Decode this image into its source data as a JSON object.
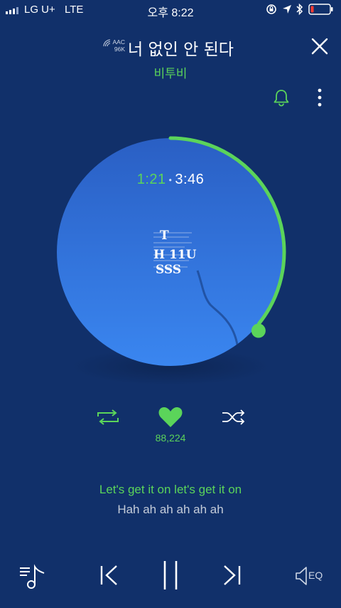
{
  "status_bar": {
    "carrier": "LG U+",
    "network": "LTE",
    "time": "오후 8:22"
  },
  "track": {
    "codec_format": "AAC",
    "codec_rate": "96K",
    "title": "너 없인 안 된다",
    "artist": "비투비"
  },
  "player": {
    "elapsed": "1:21",
    "separator": "•",
    "duration": "3:46",
    "progress_fraction": 0.358,
    "like_count": "88,224",
    "liked": true
  },
  "album_art": {
    "lines": [
      "T",
      "H 11U",
      "SSS"
    ]
  },
  "lyrics": {
    "current": "Let's get it on let's get it on",
    "next": "Hah ah ah ah ah ah"
  },
  "bottom": {
    "eq_label": "EQ"
  },
  "icons": {
    "signal": "signal-icon",
    "lock_rotation": "rotation-lock-icon",
    "location": "location-arrow-icon",
    "bluetooth": "bluetooth-icon",
    "battery": "battery-icon",
    "close": "close-icon",
    "bell": "bell-icon",
    "more": "more-vertical-icon",
    "repeat": "repeat-icon",
    "heart": "heart-icon",
    "shuffle": "shuffle-icon",
    "playlist": "playlist-icon",
    "prev": "skip-previous-icon",
    "pause": "pause-icon",
    "next": "skip-next-icon",
    "eq": "equalizer-speaker-icon"
  },
  "colors": {
    "background": "#11306a",
    "accent": "#5bd45a",
    "disc_top": "#2a5fc4",
    "disc_bottom": "#3a86f0",
    "battery_low": "#ff3b30"
  }
}
